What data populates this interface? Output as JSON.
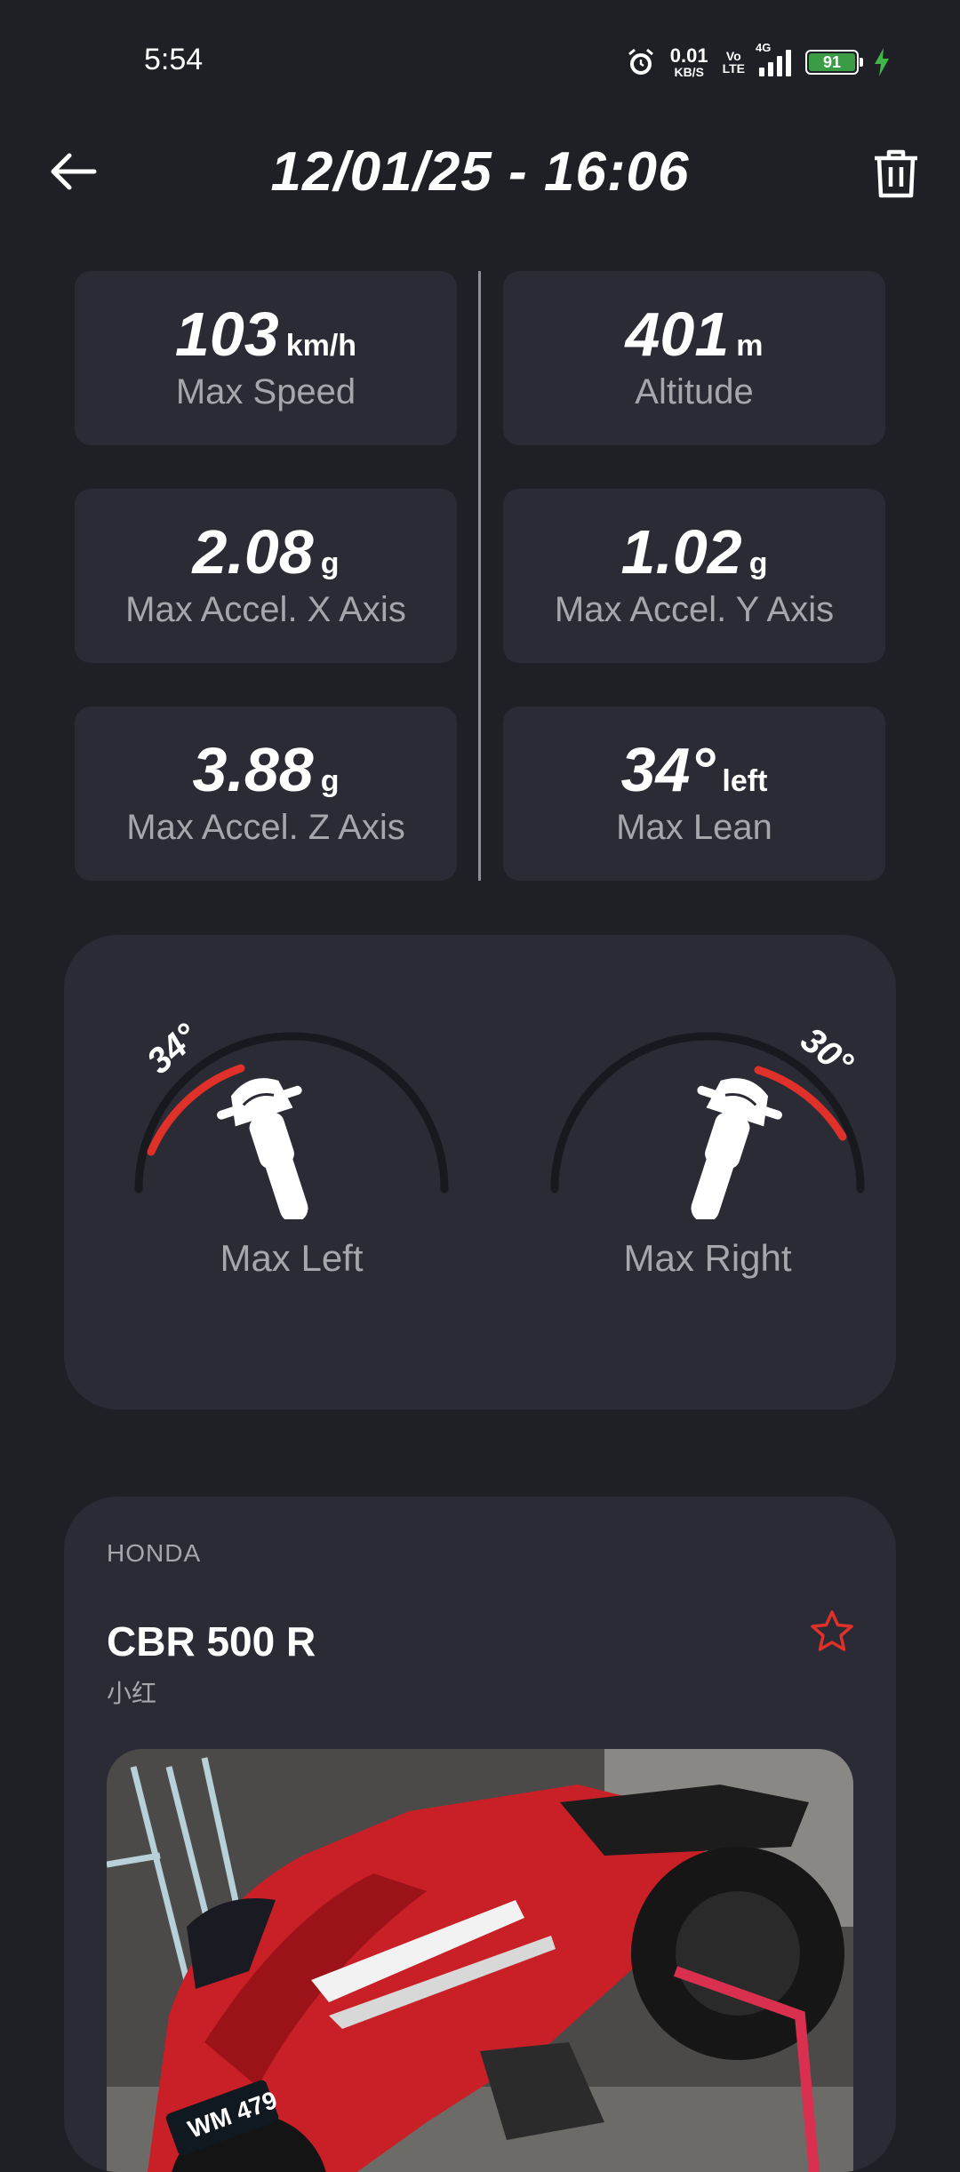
{
  "status_bar": {
    "time": "5:54",
    "net_speed_value": "0.01",
    "net_speed_unit": "KB/S",
    "volte_top": "Vo",
    "volte_bottom": "LTE",
    "network": "4G",
    "battery": "91",
    "icons": [
      "alarm-icon",
      "signal-icon",
      "battery-icon",
      "charging-icon"
    ]
  },
  "header": {
    "title": "12/01/25 - 16:06",
    "back_icon": "arrow-left-icon",
    "delete_icon": "trash-icon"
  },
  "stats": [
    {
      "value": "103",
      "unit": "km/h",
      "label": "Max Speed"
    },
    {
      "value": "401",
      "unit": "m",
      "label": "Altitude"
    },
    {
      "value": "2.08",
      "unit": "g",
      "label": "Max Accel. X Axis"
    },
    {
      "value": "1.02",
      "unit": "g",
      "label": "Max Accel. Y Axis"
    },
    {
      "value": "3.88",
      "unit": "g",
      "label": "Max Accel. Z Axis"
    },
    {
      "value": "34°",
      "unit": "left",
      "label": "Max Lean"
    }
  ],
  "lean": {
    "left": {
      "angle": "34°",
      "label": "Max Left"
    },
    "right": {
      "angle": "30°",
      "label": "Max Right"
    },
    "accent_color": "#e0302a"
  },
  "bike": {
    "brand": "HONDA",
    "model": "CBR 500 R",
    "nickname": "小红",
    "favorite_icon": "star-outline-icon",
    "photo_plate": "WM 479"
  },
  "colors": {
    "background": "#1f2026",
    "card": "#2a2b34",
    "accent": "#e0302a",
    "muted_text": "#a6a7ad"
  }
}
